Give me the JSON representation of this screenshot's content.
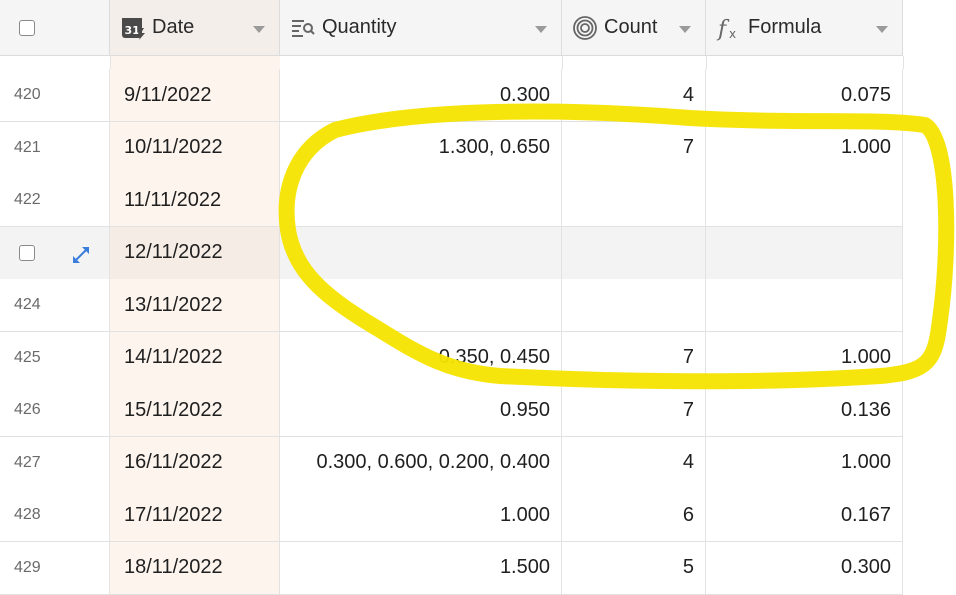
{
  "columns": [
    {
      "key": "date",
      "label": "Date",
      "icon": "date-field-icon"
    },
    {
      "key": "quantity",
      "label": "Quantity",
      "icon": "number-field-icon"
    },
    {
      "key": "count",
      "label": "Count",
      "icon": "count-field-icon"
    },
    {
      "key": "formula",
      "label": "Formula",
      "icon": "formula-field-icon"
    }
  ],
  "rows": [
    {
      "num": "420",
      "date": "9/11/2022",
      "quantity": "0.300",
      "count": "4",
      "formula": "0.075"
    },
    {
      "num": "421",
      "date": "10/11/2022",
      "quantity": "1.300, 0.650",
      "count": "7",
      "formula": "1.000"
    },
    {
      "num": "422",
      "date": "11/11/2022",
      "quantity": "",
      "count": "",
      "formula": ""
    },
    {
      "num": "",
      "date": "12/11/2022",
      "quantity": "",
      "count": "",
      "formula": "",
      "hover": true
    },
    {
      "num": "424",
      "date": "13/11/2022",
      "quantity": "",
      "count": "",
      "formula": ""
    },
    {
      "num": "425",
      "date": "14/11/2022",
      "quantity": "0.350, 0.450",
      "count": "7",
      "formula": "1.000"
    },
    {
      "num": "426",
      "date": "15/11/2022",
      "quantity": "0.950",
      "count": "7",
      "formula": "0.136"
    },
    {
      "num": "427",
      "date": "16/11/2022",
      "quantity": "0.300, 0.600, 0.200, 0.400",
      "count": "4",
      "formula": "1.000"
    },
    {
      "num": "428",
      "date": "17/11/2022",
      "quantity": "1.000",
      "count": "6",
      "formula": "0.167"
    },
    {
      "num": "429",
      "date": "18/11/2022",
      "quantity": "1.500",
      "count": "5",
      "formula": "0.300"
    }
  ],
  "colors": {
    "highlight": "#f5e400",
    "date_column": "#fdf4ee",
    "expand_icon": "#3b7ddd"
  }
}
